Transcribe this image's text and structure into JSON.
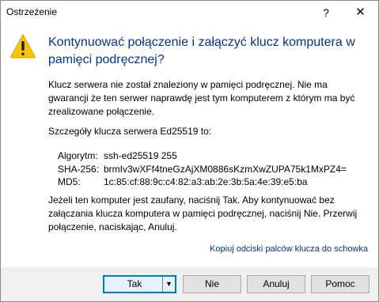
{
  "window": {
    "title": "Ostrzeżenie",
    "help_label": "?",
    "close_label": "✕"
  },
  "icon": {
    "name": "warning-icon",
    "color": "#f7c600"
  },
  "heading": "Kontynuować połączenie i załączyć klucz komputera w pamięci podręcznej?",
  "body": {
    "p1": "Klucz serwera nie został znaleziony w pamięci podręcznej. Nie ma gwarancji że ten serwer naprawdę jest tym komputerem z którym ma być zrealizowane połączenie.",
    "p2": "Szczegóły klucza serwera Ed25519 to:",
    "details": [
      {
        "key": "Algorytm:",
        "value": "ssh-ed25519 255"
      },
      {
        "key": "SHA-256:",
        "value": "brmIv3wXFf4tneGzAjXM0886sKzmXwZUPA75k1MxPZ4="
      },
      {
        "key": "MD5:",
        "value": "1c:85:cf:88:9c:c4:82:a3:ab:2e:3b:5a:4e:39:e5:ba"
      }
    ],
    "p3": "Jeżeli ten komputer jest zaufany, naciśnij Tak. Aby kontynuować bez załączania klucza komputera w pamięci podręcznej, naciśnij Nie. Przerwij połączenie, naciskając, Anuluj."
  },
  "link": "Kopiuj odciski palców klucza do schowka",
  "buttons": {
    "yes": "Tak",
    "no": "Nie",
    "cancel": "Anuluj",
    "help": "Pomoc"
  },
  "colors": {
    "heading": "#003399",
    "link": "#003399",
    "default_button_border": "#0078d7"
  }
}
